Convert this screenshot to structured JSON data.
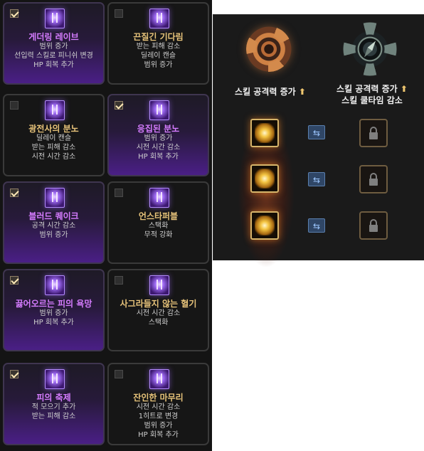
{
  "skill_cards": [
    {
      "title": "게더링 레이브",
      "lines": [
        "범위 증가",
        "선입력 스킬로 피니쉬 변경",
        "HP 회복 추가"
      ],
      "selected": true,
      "tier": "I"
    },
    {
      "title": "끈질긴 기다림",
      "lines": [
        "받는 피해 감소",
        "딜레이 캔슬",
        "범위 증가"
      ],
      "selected": false,
      "tier": "II"
    },
    {
      "title": "광전사의 분노",
      "lines": [
        "딜레이 캔슬",
        "받는 피해 감소",
        "시전 시간 감소"
      ],
      "selected": false,
      "tier": "I"
    },
    {
      "title": "응집된 분노",
      "lines": [
        "범위 증가",
        "시전 시간 감소",
        "HP 회복 추가"
      ],
      "selected": true,
      "tier": "II"
    },
    {
      "title": "블러드 퀘이크",
      "lines": [
        "공격 시간 감소",
        "범위 증가"
      ],
      "selected": true,
      "tier": "I"
    },
    {
      "title": "언스타퍼블",
      "lines": [
        "스택화",
        "무적 강화"
      ],
      "selected": false,
      "tier": "II"
    },
    {
      "title": "끓어오르는 피의 욕망",
      "lines": [
        "범위 증가",
        "HP 회복 추가"
      ],
      "selected": true,
      "tier": "I"
    },
    {
      "title": "사그라들지 않는 혈기",
      "lines": [
        "시전 시간 감소",
        "스택화"
      ],
      "selected": false,
      "tier": "II"
    },
    {
      "title": "피의 축제",
      "lines": [
        "적 모으기 추가",
        "받는 피해 감소"
      ],
      "selected": true,
      "tier": "I"
    },
    {
      "title": "잔인한 마무리",
      "lines": [
        "시전 시간 감소",
        "1히트로 변경",
        "범위 증가",
        "HP 회복 추가"
      ],
      "selected": false,
      "tier": "II"
    }
  ],
  "right_panel": {
    "left_effect": {
      "label": "스킬 공격력 증가",
      "arrow": "⬆",
      "icon": "flame-spiral-emblem-icon"
    },
    "right_effect": {
      "line1": "스킬 공격력 증가",
      "arrow": "⬆",
      "line2": "스킬 쿨타임 감소",
      "icon": "compass-emblem-icon"
    },
    "swap_glyph": "⇆",
    "rows": [
      {
        "left_icon": "burst-skill-icon",
        "swap_icon": "swap-icon",
        "right_icon": "lock-icon"
      },
      {
        "left_icon": "spiral-skill-icon",
        "swap_icon": "swap-icon",
        "right_icon": "lock-icon"
      },
      {
        "left_icon": "explosion-skill-icon",
        "swap_icon": "swap-icon",
        "right_icon": "lock-icon"
      }
    ]
  },
  "colors": {
    "selected_title": "#d57cff",
    "unselected_title": "#e7c37a",
    "accent_gold": "#d6b46a",
    "selected_bg": "#4a1f86"
  }
}
